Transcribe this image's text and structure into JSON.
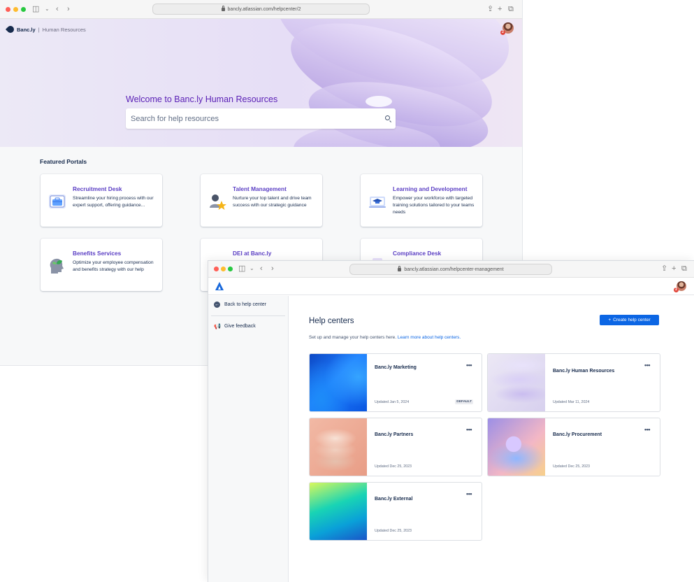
{
  "portal_window": {
    "chrome": {
      "url": "bancly.atlassian.com/helpcenter/2"
    },
    "brand": {
      "name": "Banc.ly",
      "separator": "|",
      "section": "Human Resources"
    },
    "user": {
      "notification_count": "2"
    },
    "hero": {
      "welcome": "Welcome to Banc.ly Human Resources",
      "search_placeholder": "Search for help resources"
    },
    "featured": {
      "title": "Featured Portals",
      "portals": [
        {
          "title": "Recruitment Desk",
          "desc": "Streamline your hiring process with our expert support, offering guidance...",
          "icon": "briefcase-icon"
        },
        {
          "title": "Talent Management",
          "desc": "Nurture your top talent and drive team success with our strategic guidance",
          "icon": "star-person-icon"
        },
        {
          "title": "Learning and Development",
          "desc": "Empower your workforce with targeted training solutions tailored to your teams needs",
          "icon": "graduation-cap-icon"
        },
        {
          "title": "Benefits Services",
          "desc": "Optimize your employee compensation and benefits strategy with our help",
          "icon": "head-leaf-icon"
        },
        {
          "title": "DEI at Banc.ly",
          "desc": "",
          "icon": "people-icon"
        },
        {
          "title": "Compliance Desk",
          "desc": "",
          "icon": "document-icon"
        }
      ]
    }
  },
  "management_window": {
    "chrome": {
      "url": "bancly.atlassian.com/helpcenter-management"
    },
    "user": {
      "notification_count": "2"
    },
    "sidebar": {
      "back": "Back to help center",
      "feedback": "Give feedback"
    },
    "page": {
      "title": "Help centers",
      "subtitle": "Set up and manage your help centers here.",
      "learn_more": "Learn more about help centers.",
      "create_button": "Create help center"
    },
    "help_centers": [
      {
        "name": "Banc.ly Marketing",
        "updated": "Updated Jan 5, 2024",
        "badge": "DEFAULT"
      },
      {
        "name": "Banc.ly Human Resources",
        "updated": "Updated Mar 11, 2024",
        "badge": ""
      },
      {
        "name": "Banc.ly Partners",
        "updated": "Updated Dec 25, 2023",
        "badge": ""
      },
      {
        "name": "Banc.ly Procurement",
        "updated": "Updated Dec 25, 2023",
        "badge": ""
      },
      {
        "name": "Banc.ly External",
        "updated": "Updated Dec 25, 2023",
        "badge": ""
      }
    ],
    "more_glyph": "•••"
  },
  "colors": {
    "accent": "#0c66e4",
    "portal_title": "#5b3fc4",
    "welcome": "#5b21b6"
  }
}
